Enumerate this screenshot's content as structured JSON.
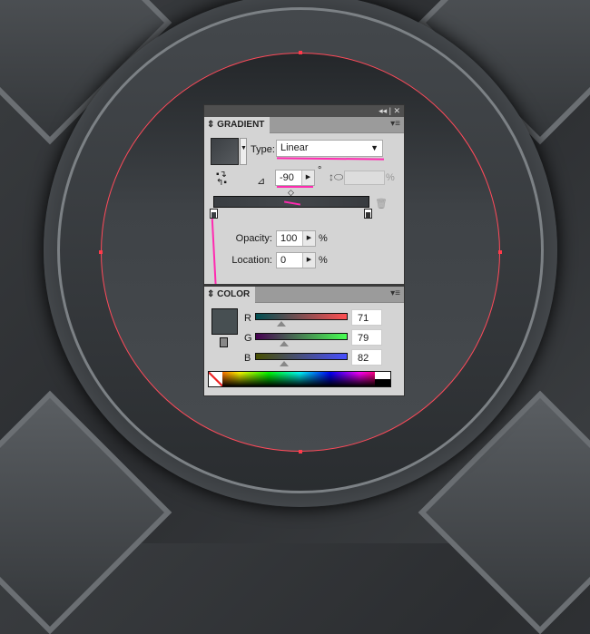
{
  "gradient_panel": {
    "title": "GRADIENT",
    "type_label": "Type:",
    "type_value": "Linear",
    "angle_value": "-90",
    "degree_symbol": "°",
    "aspect_percent": "%",
    "opacity_label": "Opacity:",
    "opacity_value": "100",
    "location_label": "Location:",
    "location_value": "0",
    "percent": "%",
    "collapse": "◂◂",
    "close": "✕"
  },
  "color_panel": {
    "title": "COLOR",
    "r_label": "R",
    "g_label": "G",
    "b_label": "B",
    "r_value": "71",
    "g_value": "79",
    "b_value": "82"
  },
  "colors": {
    "fill": "#474f52",
    "annotation": "#ff2ab0",
    "path": "#ff3a4a"
  }
}
